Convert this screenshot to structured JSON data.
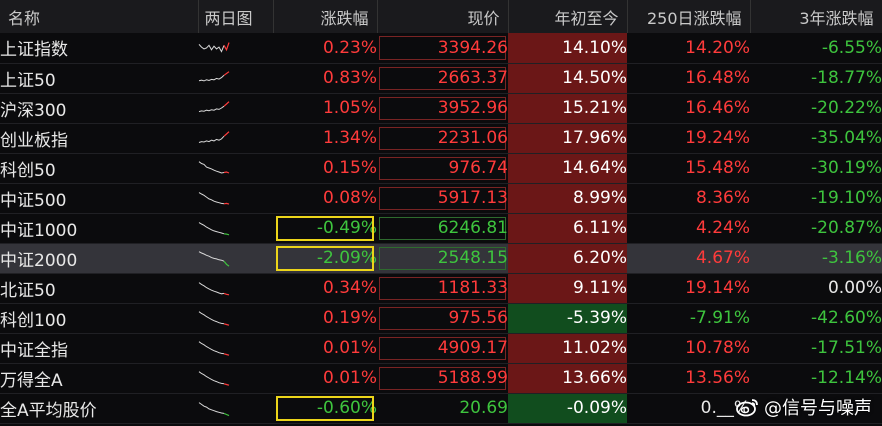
{
  "headers": {
    "name": "名称",
    "two_day": "两日图",
    "change": "涨跌幅",
    "price": "现价",
    "ytd": "年初至今",
    "d250": "250日涨跌幅",
    "y3": "3年涨跌幅"
  },
  "rows": [
    {
      "name": "上证指数",
      "change": "0.23%",
      "price": "3394.26",
      "ytd": "14.10%",
      "d250": "14.20%",
      "y3": "-6.55%",
      "spark": [
        0.3,
        0.45,
        0.55,
        0.5,
        0.35,
        0.6,
        0.4,
        0.55,
        0.45,
        0.7,
        0.35,
        0.6,
        0.2
      ]
    },
    {
      "name": "上证50",
      "change": "0.83%",
      "price": "2663.37",
      "ytd": "14.50%",
      "d250": "16.48%",
      "y3": "-18.77%",
      "spark": [
        0.65,
        0.62,
        0.66,
        0.6,
        0.64,
        0.58,
        0.6,
        0.52,
        0.56,
        0.48,
        0.35,
        0.25,
        0.15
      ]
    },
    {
      "name": "沪深300",
      "change": "1.05%",
      "price": "3952.96",
      "ytd": "15.21%",
      "d250": "16.46%",
      "y3": "-20.22%",
      "spark": [
        0.7,
        0.66,
        0.68,
        0.62,
        0.65,
        0.6,
        0.62,
        0.55,
        0.58,
        0.5,
        0.4,
        0.28,
        0.15
      ]
    },
    {
      "name": "创业板指",
      "change": "1.34%",
      "price": "2231.06",
      "ytd": "17.96%",
      "d250": "19.24%",
      "y3": "-35.04%",
      "spark": [
        0.75,
        0.7,
        0.72,
        0.66,
        0.7,
        0.62,
        0.66,
        0.58,
        0.62,
        0.55,
        0.4,
        0.28,
        0.15
      ]
    },
    {
      "name": "科创50",
      "change": "0.15%",
      "price": "976.74",
      "ytd": "14.64%",
      "d250": "15.48%",
      "y3": "-30.19%",
      "spark": [
        0.15,
        0.25,
        0.3,
        0.45,
        0.5,
        0.55,
        0.62,
        0.68,
        0.72,
        0.78,
        0.75,
        0.72,
        0.78
      ]
    },
    {
      "name": "中证500",
      "change": "0.08%",
      "price": "5917.13",
      "ytd": "8.99%",
      "d250": "8.36%",
      "y3": "-19.10%",
      "spark": [
        0.2,
        0.28,
        0.35,
        0.45,
        0.55,
        0.6,
        0.68,
        0.72,
        0.76,
        0.8,
        0.82,
        0.8,
        0.84
      ]
    },
    {
      "name": "中证1000",
      "change": "-0.49%",
      "price": "6246.81",
      "ytd": "6.11%",
      "d250": "4.24%",
      "y3": "-20.87%",
      "spark": [
        0.2,
        0.28,
        0.35,
        0.45,
        0.52,
        0.6,
        0.66,
        0.7,
        0.74,
        0.78,
        0.82,
        0.84,
        0.88
      ]
    },
    {
      "name": "中证2000",
      "change": "-2.09%",
      "price": "2548.15",
      "ytd": "6.20%",
      "d250": "4.67%",
      "y3": "-3.16%",
      "spark": [
        0.15,
        0.22,
        0.28,
        0.35,
        0.4,
        0.48,
        0.52,
        0.55,
        0.6,
        0.62,
        0.68,
        0.85,
        0.95
      ]
    },
    {
      "name": "北证50",
      "change": "0.34%",
      "price": "1181.33",
      "ytd": "9.11%",
      "d250": "19.14%",
      "y3": "0.00%",
      "spark": [
        0.2,
        0.3,
        0.38,
        0.48,
        0.55,
        0.62,
        0.68,
        0.72,
        0.78,
        0.82,
        0.8,
        0.85,
        0.88
      ]
    },
    {
      "name": "科创100",
      "change": "0.19%",
      "price": "975.56",
      "ytd": "-5.39%",
      "d250": "-7.91%",
      "y3": "-42.60%",
      "spark": [
        0.15,
        0.25,
        0.32,
        0.42,
        0.5,
        0.58,
        0.65,
        0.7,
        0.76,
        0.8,
        0.82,
        0.86,
        0.9
      ]
    },
    {
      "name": "中证全指",
      "change": "0.01%",
      "price": "4909.17",
      "ytd": "11.02%",
      "d250": "10.78%",
      "y3": "-17.51%",
      "spark": [
        0.15,
        0.25,
        0.32,
        0.42,
        0.5,
        0.58,
        0.65,
        0.7,
        0.76,
        0.8,
        0.82,
        0.86,
        0.9
      ]
    },
    {
      "name": "万得全A",
      "change": "0.01%",
      "price": "5188.99",
      "ytd": "13.66%",
      "d250": "13.56%",
      "y3": "-12.14%",
      "spark": [
        0.15,
        0.25,
        0.32,
        0.42,
        0.5,
        0.58,
        0.65,
        0.7,
        0.76,
        0.8,
        0.82,
        0.86,
        0.9
      ]
    },
    {
      "name": "全A平均股价",
      "change": "-0.60%",
      "price": "20.69",
      "ytd": "-0.09%",
      "d250": "0.__%",
      "y3": "",
      "spark": [
        0.2,
        0.3,
        0.4,
        0.45,
        0.55,
        0.6,
        0.65,
        0.7,
        0.74,
        0.78,
        0.8,
        0.86,
        0.92
      ]
    }
  ],
  "watermark": {
    "text": "@信号与噪声",
    "icon": "weibo-icon"
  },
  "colors": {
    "up": "#ff3b3b",
    "down": "#3ec43e",
    "highlight": "#ecd51a"
  }
}
